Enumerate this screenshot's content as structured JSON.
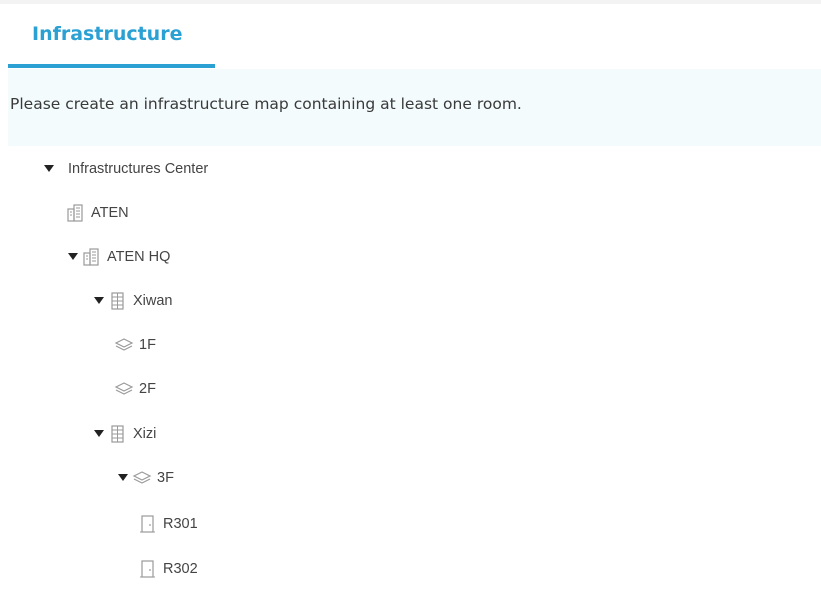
{
  "tab": {
    "label": "Infrastructure",
    "accent_color": "#2aa0d3"
  },
  "notice": {
    "text": "Please create an infrastructure map containing at least one room."
  },
  "tree": {
    "root": {
      "label": "Infrastructures Center",
      "expanded": true
    },
    "nodes": [
      {
        "label": "ATEN",
        "type": "building-group",
        "icon": "buildings-icon",
        "expanded": false
      },
      {
        "label": "ATEN HQ",
        "type": "building-group",
        "icon": "buildings-icon",
        "expanded": true
      },
      {
        "label": "Xiwan",
        "type": "building",
        "icon": "building-icon",
        "expanded": true
      },
      {
        "label": "1F",
        "type": "floor",
        "icon": "layers-icon"
      },
      {
        "label": "2F",
        "type": "floor",
        "icon": "layers-icon"
      },
      {
        "label": "Xizi",
        "type": "building",
        "icon": "building-icon",
        "expanded": true
      },
      {
        "label": "3F",
        "type": "floor",
        "icon": "layers-icon",
        "expanded": true
      },
      {
        "label": "R301",
        "type": "room",
        "icon": "door-icon"
      },
      {
        "label": "R302",
        "type": "room",
        "icon": "door-icon"
      }
    ]
  }
}
